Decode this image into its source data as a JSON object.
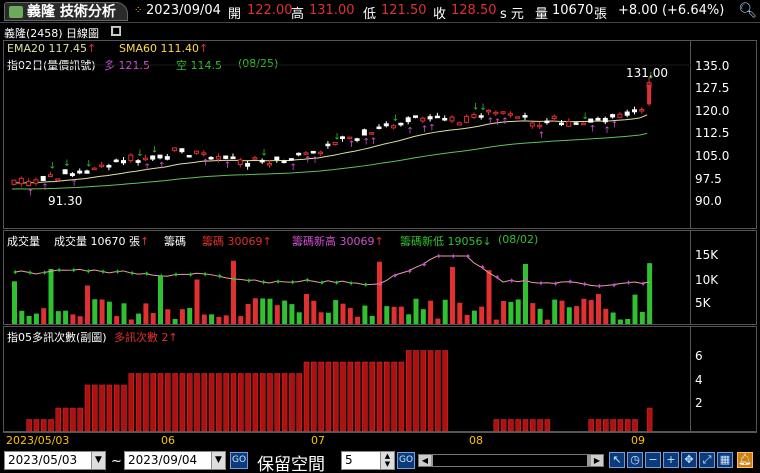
{
  "tab": {
    "label": "義隆 技術分析"
  },
  "quote": {
    "date": "2023/09/04",
    "open_label": "開",
    "open": "122.00",
    "high_label": "高",
    "high": "131.00",
    "low_label": "低",
    "low": "121.50",
    "close_label": "收",
    "close": "128.50",
    "unit": "s 元",
    "volume_label": "量",
    "volume": "10670",
    "volume_unit": "張",
    "change": "+8.00 (+6.64%)"
  },
  "stock": {
    "name": "義隆(2458)",
    "period": "日線圖"
  },
  "price_panel": {
    "ema": "EMA20 117.45",
    "sma": "SMA60 111.40",
    "signal_title": "指02日(量價訊號)",
    "long": "多 121.5",
    "short": "空 114.5",
    "date": "(08/25)",
    "max_label": "131.00",
    "min_label": "91.30",
    "yticks": [
      "135.0",
      "127.5",
      "120.0",
      "112.5",
      "105.0",
      "97.5",
      "90.0"
    ]
  },
  "volume_panel": {
    "title": "成交量",
    "vol_text": "成交量 10670 張",
    "chip_label": "籌碼",
    "chip_val": "籌碼 30069",
    "chip_high": "籌碼新高 30069",
    "chip_low": "籌碼新低 19056",
    "chip_date": "(08/02)",
    "yticks": [
      "15K",
      "10K",
      "5K"
    ]
  },
  "count_panel": {
    "title": "指05多訊次數(副圖)",
    "count_label": "多訊次數 2",
    "yticks": [
      "6",
      "4",
      "2"
    ]
  },
  "date_axis": {
    "labels": [
      "2023/05/03",
      "06",
      "07",
      "08",
      "09"
    ]
  },
  "bottom": {
    "start_date": "2023/05/03",
    "tilde": "~",
    "end_date": "2023/09/04",
    "go": "GO",
    "reserve_label": "保留空間",
    "reserve_value": "5"
  },
  "colors": {
    "up": "#e03030",
    "down": "#30c030",
    "ema": "#e0e0a0",
    "sma": "#60c060",
    "signal": "#d050d0"
  }
}
